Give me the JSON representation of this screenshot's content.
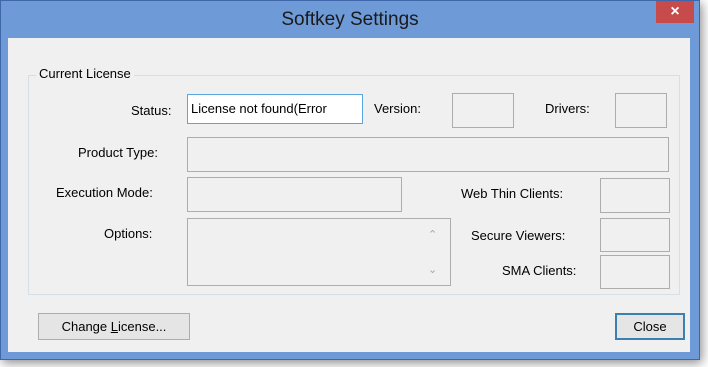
{
  "window": {
    "title": "Softkey Settings",
    "close_glyph": "×"
  },
  "group": {
    "label": "Current License"
  },
  "labels": {
    "status": "Status:",
    "version": "Version:",
    "drivers": "Drivers:",
    "product_type": "Product Type:",
    "execution_mode": "Execution Mode:",
    "web_thin_clients": "Web Thin Clients:",
    "options": "Options:",
    "secure_viewers": "Secure Viewers:",
    "sma_clients": "SMA Clients:"
  },
  "fields": {
    "status_value": "License not found(Error",
    "version_value": "",
    "drivers_value": "",
    "product_type_value": "",
    "execution_mode_value": "",
    "web_thin_clients_value": "",
    "secure_viewers_value": "",
    "sma_clients_value": "",
    "options_value": ""
  },
  "buttons": {
    "change_license_prefix": "Change ",
    "change_license_mnemonic": "L",
    "change_license_suffix": "icense...",
    "close": "Close"
  },
  "colors": {
    "titlebar": "#6e9ad8",
    "close_button": "#c74b4b",
    "dialog_background": "#f0f0f0",
    "focus_border": "#5aa6e0"
  }
}
